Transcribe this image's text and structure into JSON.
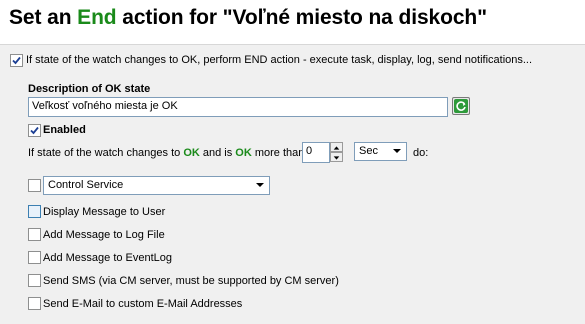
{
  "title": {
    "part1": "Set an ",
    "accent": "End",
    "part2": " action for \"Voľné miesto na diskoch\""
  },
  "main_checkbox": {
    "checked": true,
    "label": "If state of the watch changes to OK, perform END action - execute task, display, log, send notifications..."
  },
  "description": {
    "heading": "Description of OK state",
    "value": "Veľkosť voľného miesta je OK",
    "refresh_icon": "refresh-icon"
  },
  "enabled": {
    "checked": true,
    "label": "Enabled"
  },
  "condition": {
    "prefix": "If state of the watch changes to ",
    "ok1": "OK",
    "middle": " and is ",
    "ok2": "OK",
    "suffix": " more than",
    "amount": "0",
    "unit": "Sec",
    "do": "do:"
  },
  "actions": [
    {
      "checked": false,
      "label": "Control Service",
      "type": "select"
    },
    {
      "checked": false,
      "label": "Display Message to User"
    },
    {
      "checked": false,
      "label": "Add Message to Log File"
    },
    {
      "checked": false,
      "label": "Add Message to EventLog"
    },
    {
      "checked": false,
      "label": "Send SMS (via CM server, must be supported by CM server)"
    },
    {
      "checked": false,
      "label": "Send E-Mail to custom E-Mail Addresses"
    }
  ],
  "colors": {
    "accent_green": "#1a8a1a",
    "panel_bg": "#f0f0f0",
    "border_blue": "#7f9db9"
  }
}
